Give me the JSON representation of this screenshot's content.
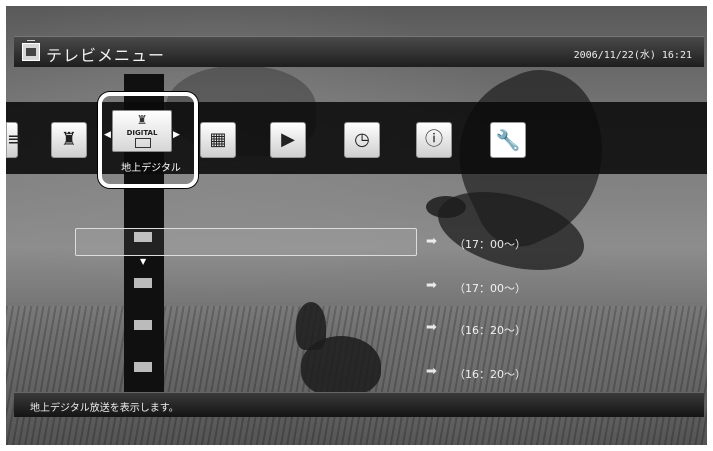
{
  "header": {
    "title": "テレビメニュー",
    "datetime": "2006/11/22(水) 16:21"
  },
  "menu": {
    "selected_label": "地上デジタル",
    "selected_icon_text": "DIGITAL",
    "items": [
      {
        "icon": "list-icon"
      },
      {
        "icon": "tv-tower-icon"
      },
      {
        "icon": "digital-terrestrial-icon"
      },
      {
        "icon": "tv-guide-grid-icon"
      },
      {
        "icon": "playback-list-icon"
      },
      {
        "icon": "timer-recording-list-icon"
      },
      {
        "icon": "info-speech-icon"
      },
      {
        "icon": "wrench-icon"
      }
    ]
  },
  "rows": [
    {
      "time": "（17：00～）"
    },
    {
      "time": "（17：00～）"
    },
    {
      "time": "（16：20～）"
    },
    {
      "time": "（16：20～）"
    }
  ],
  "status": {
    "text": "地上デジタル放送を表示します。"
  }
}
